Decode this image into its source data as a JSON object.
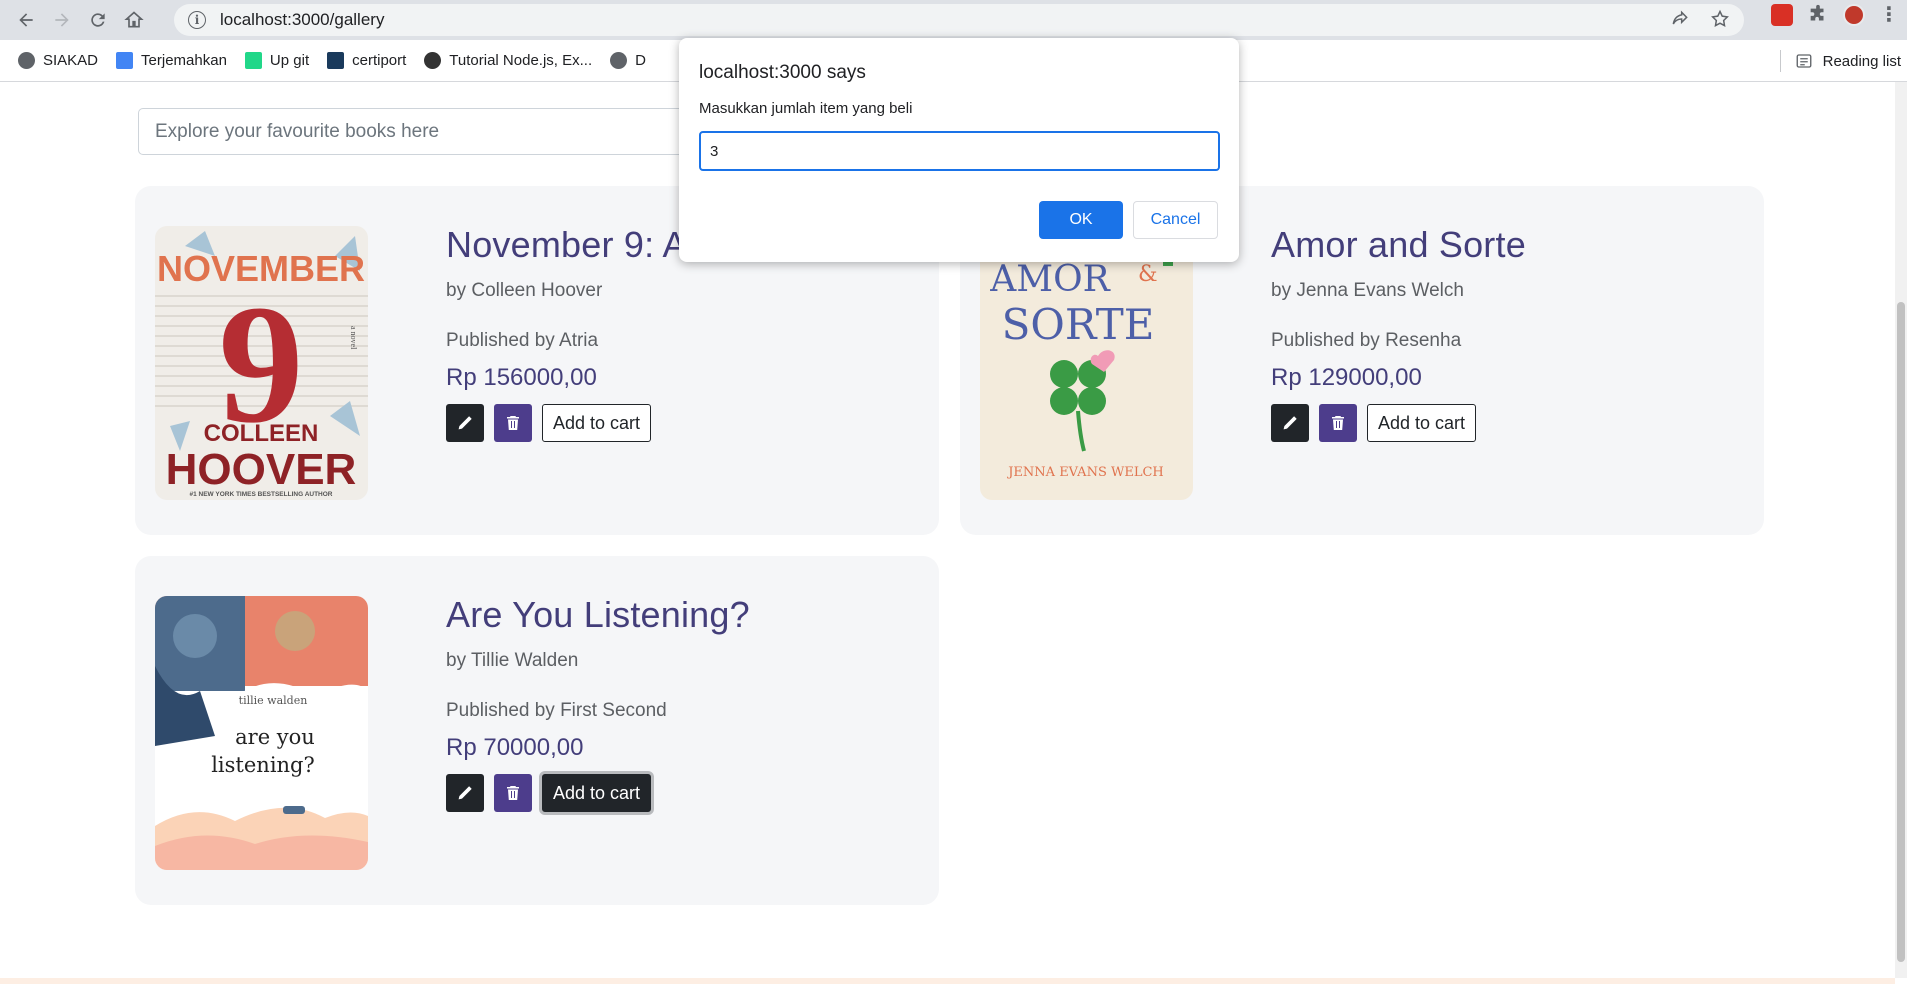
{
  "browser": {
    "url": "localhost:3000/gallery",
    "bookmarks": [
      {
        "label": "SIAKAD",
        "icon": "globe-icon"
      },
      {
        "label": "Terjemahkan",
        "icon": "translate-icon"
      },
      {
        "label": "Up git",
        "icon": "pc-icon"
      },
      {
        "label": "certiport",
        "icon": "certiport-icon"
      },
      {
        "label": "Tutorial Node.js, Ex...",
        "icon": "github-icon"
      },
      {
        "label": "D",
        "icon": "globe-icon"
      }
    ],
    "reading_list": "Reading list"
  },
  "page": {
    "search_placeholder": "Explore your favourite books here",
    "books": [
      {
        "title": "November 9: A Novel",
        "author": "by Colleen Hoover",
        "publisher": "Published by Atria",
        "price": "Rp 156000,00",
        "cart_label": "Add to cart",
        "cover_text": {
          "top": "NOVEMBER",
          "num": "9",
          "mid": "COLLEEN",
          "bottom": "HOOVER",
          "tag": "#1 NEW YORK TIMES BESTSELLING AUTHOR",
          "novel": "a novel"
        }
      },
      {
        "title": "Amor and Sorte",
        "author": "by Jenna Evans Welch",
        "publisher": "Published by Resenha",
        "price": "Rp 129000,00",
        "cart_label": "Add to cart",
        "cover_text": {
          "top": "AMOR",
          "amp": "&",
          "mid": "SORTE",
          "bottom": "JENNA EVANS WELCH"
        }
      },
      {
        "title": "Are You Listening?",
        "author": "by Tillie Walden",
        "publisher": "Published by First Second",
        "price": "Rp 70000,00",
        "cart_label": "Add to cart",
        "cover_text": {
          "author": "tillie walden",
          "line1": "are you",
          "line2": "listening?"
        }
      }
    ]
  },
  "dialog": {
    "title": "localhost:3000 says",
    "message": "Masukkan jumlah item yang beli",
    "input_value": "3",
    "ok_label": "OK",
    "cancel_label": "Cancel"
  },
  "colors": {
    "accent": "#433e7a",
    "delete_button": "#4d3d8c",
    "dialog_primary": "#1a73e8"
  }
}
